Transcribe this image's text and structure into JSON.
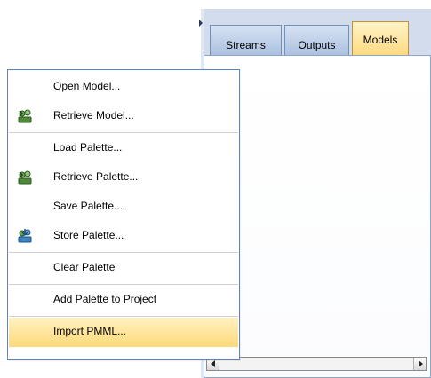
{
  "tabs": [
    {
      "label": "Streams",
      "active": false
    },
    {
      "label": "Outputs",
      "active": false
    },
    {
      "label": "Models",
      "active": true
    }
  ],
  "menu": {
    "items": [
      {
        "label": "Open Model...",
        "icon": "none"
      },
      {
        "label": "Retrieve Model...",
        "icon": "retrieve-icon"
      },
      {
        "label": "Load Palette...",
        "icon": "none"
      },
      {
        "label": "Retrieve Palette...",
        "icon": "retrieve-icon"
      },
      {
        "label": "Save Palette...",
        "icon": "none"
      },
      {
        "label": "Store Palette...",
        "icon": "store-icon"
      },
      {
        "label": "Clear Palette",
        "icon": "none"
      },
      {
        "label": "Add Palette to Project",
        "icon": "none"
      },
      {
        "label": "Import PMML...",
        "icon": "none",
        "highlighted": true
      }
    ]
  },
  "colors": {
    "menu_border": "#5f84c2",
    "highlight": "#ffd97a",
    "active_tab": "#ffd36e",
    "panel_bg": "#dfe7f3"
  }
}
